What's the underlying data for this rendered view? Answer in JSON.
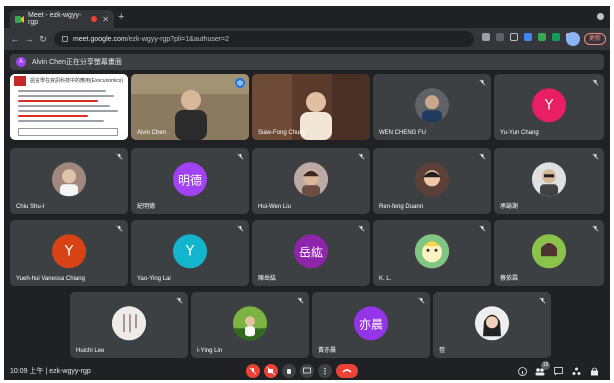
{
  "browser": {
    "tab_title": "Meet - ezk-wgyy-rgp",
    "url_host": "meet.google.com",
    "url_path": "/ezk-wgyy-rgp?pli=1&authuser=2",
    "update_label": "更新"
  },
  "banner": {
    "avatar_letter": "A",
    "text": "Alvin Chen正在分享螢幕畫面"
  },
  "slide": {
    "title": "語言學在資訊科技中的應用(Exocunomics)"
  },
  "participants": [
    {
      "name": "Alvin Chen",
      "kind": "video"
    },
    {
      "name": "Siaw-Fong Chung",
      "kind": "video"
    },
    {
      "name": "WEN CHENG FU",
      "kind": "photo",
      "color": "#5f6368"
    },
    {
      "name": "Yu-Yun Chang",
      "kind": "letter",
      "letter": "Y",
      "color": "#e91e63"
    },
    {
      "name": "Chiu Shu-I",
      "kind": "photo",
      "color": "#8d6e63"
    },
    {
      "name": "紀明德",
      "kind": "letter",
      "letter": "明德",
      "color": "#a142f4"
    },
    {
      "name": "Hui-Wen Liu",
      "kind": "photo",
      "color": "#a1887f"
    },
    {
      "name": "Ren-feng Duann",
      "kind": "photo",
      "color": "#6d4c41"
    },
    {
      "name": "承諭謝",
      "kind": "photo",
      "color": "#9e9e9e"
    },
    {
      "name": "Yueh-hui Vanessa Chiang",
      "kind": "letter",
      "letter": "Y",
      "color": "#d84315"
    },
    {
      "name": "Yao-Ying Lai",
      "kind": "letter",
      "letter": "Y",
      "color": "#12b5cb"
    },
    {
      "name": "陳岳紘",
      "kind": "letter",
      "letter": "岳紘",
      "color": "#8e24aa"
    },
    {
      "name": "K. L.",
      "kind": "photo",
      "color": "#fdd663"
    },
    {
      "name": "蔡依霖",
      "kind": "photo",
      "color": "#7cb342"
    },
    {
      "name": "Huichi Lee",
      "kind": "photo",
      "color": "#d7ccc8"
    },
    {
      "name": "I-Ying Lin",
      "kind": "photo",
      "color": "#558b2f"
    },
    {
      "name": "黃亦晨",
      "kind": "letter",
      "letter": "亦晨",
      "color": "#9334e6"
    },
    {
      "name": "愷",
      "kind": "photo",
      "color": "#bcaaa4"
    }
  ],
  "bottom": {
    "time": "10:09 上午",
    "meeting_code": "ezk-wgyy-rgp",
    "participant_count": "19"
  }
}
